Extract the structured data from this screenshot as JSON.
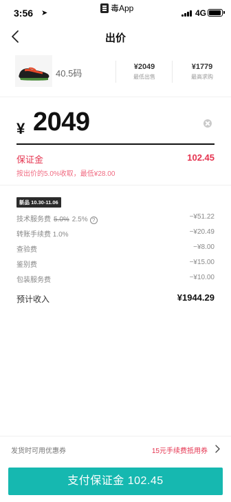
{
  "status_bar": {
    "time": "3:56",
    "app_name": "毒App",
    "network": "4G",
    "battery_level": 0.95
  },
  "nav": {
    "title": "出价",
    "back_icon": "chevron-left-icon"
  },
  "product": {
    "size": "40.5码",
    "lowest_sell_value": "¥2049",
    "lowest_sell_label": "最低出售",
    "highest_buy_value": "¥1779",
    "highest_buy_label": "最高求购"
  },
  "price_input": {
    "currency": "¥",
    "amount": "2049",
    "clear_icon": "clear-icon"
  },
  "deposit": {
    "label": "保证金",
    "value": "102.45",
    "note": "按出价的5.0%收取，最低¥28.00"
  },
  "fees": {
    "badge": "新品 10.30-11.06",
    "rows": [
      {
        "name": "技术服务费",
        "old_rate": "5.0%",
        "rate": "2.5%",
        "amount": "−¥51.22"
      },
      {
        "name": "转账手续费 1.0%",
        "amount": "−¥20.49"
      },
      {
        "name": "查验费",
        "amount": "−¥8.00"
      },
      {
        "name": "鉴别费",
        "amount": "−¥15.00"
      },
      {
        "name": "包装服务费",
        "amount": "−¥10.00"
      }
    ]
  },
  "income": {
    "label": "预计收入",
    "value": "¥1944.29"
  },
  "coupon": {
    "label": "发货时可用优惠券",
    "value": "15元手续费抵用券"
  },
  "pay_button": {
    "label": "支付保证金 102.45"
  },
  "colors": {
    "accent": "#16b8b0",
    "alert": "#e53450"
  }
}
